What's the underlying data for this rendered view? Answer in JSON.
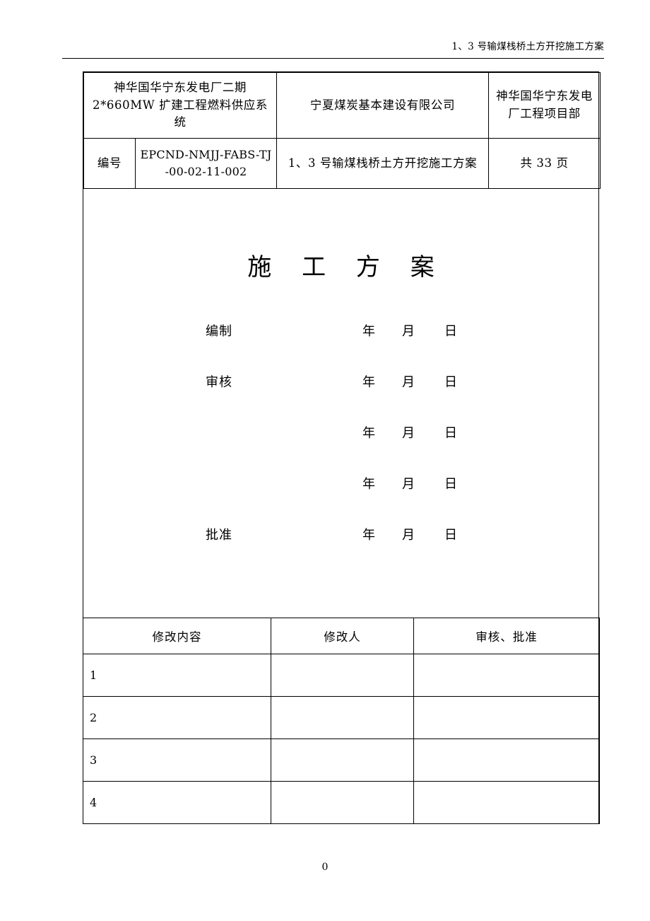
{
  "header": {
    "running_title": "1、3 号输煤栈桥土方开挖施工方案"
  },
  "info_table": {
    "row1": {
      "project": "神华国华宁东发电厂二期2*660MW 扩建工程燃料供应系统",
      "company": "宁夏煤炭基本建设有限公司",
      "department": "神华国华宁东发电厂工程项目部"
    },
    "row2": {
      "code_label": "编号",
      "code_value": "EPCND-NMJJ-FABS-TJ -00-02-11-002",
      "doc_title": "1、3 号输煤栈桥土方开挖施工方案",
      "page_count": "共 33 页"
    }
  },
  "cover": {
    "big_title": "施 工 方 案"
  },
  "signatures": {
    "date_year": "年",
    "date_month": "月",
    "date_day": "日",
    "rows": [
      {
        "label": "编制"
      },
      {
        "label": "审核"
      },
      {
        "label": ""
      },
      {
        "label": ""
      },
      {
        "label": "批准"
      }
    ]
  },
  "revision_table": {
    "headers": [
      "修改内容",
      "修改人",
      "审核、批准"
    ],
    "rows": [
      {
        "no": "1",
        "content": "",
        "person": "",
        "approver": ""
      },
      {
        "no": "2",
        "content": "",
        "person": "",
        "approver": ""
      },
      {
        "no": "3",
        "content": "",
        "person": "",
        "approver": ""
      },
      {
        "no": "4",
        "content": "",
        "person": "",
        "approver": ""
      }
    ]
  },
  "footer": {
    "page_number": "0"
  }
}
